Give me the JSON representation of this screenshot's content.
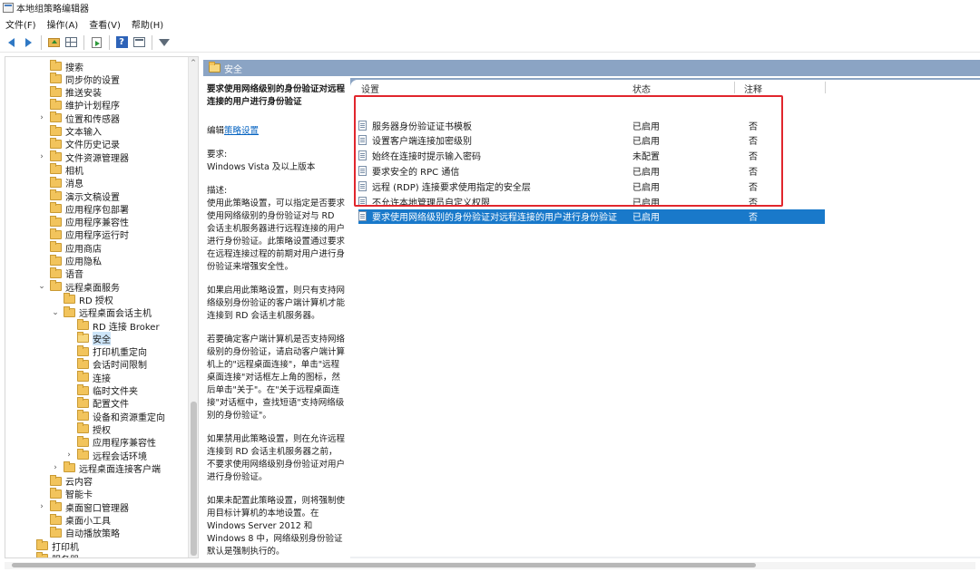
{
  "window": {
    "title": "本地组策略编辑器"
  },
  "menu": [
    "文件(F)",
    "操作(A)",
    "查看(V)",
    "帮助(H)"
  ],
  "toolbar": {
    "icons": [
      "back-arrow-icon",
      "forward-arrow-icon",
      "up-folder-icon",
      "show-hide-tree-icon",
      "export-list-icon",
      "help-icon",
      "properties-icon",
      "filter-icon"
    ],
    "help_glyph": "?"
  },
  "tree": {
    "items": [
      {
        "label": "搜索"
      },
      {
        "label": "同步你的设置"
      },
      {
        "label": "推送安装"
      },
      {
        "label": "维护计划程序"
      },
      {
        "label": "位置和传感器",
        "expander": "›"
      },
      {
        "label": "文本输入"
      },
      {
        "label": "文件历史记录"
      },
      {
        "label": "文件资源管理器",
        "expander": "›"
      },
      {
        "label": "相机"
      },
      {
        "label": "消息"
      },
      {
        "label": "演示文稿设置"
      },
      {
        "label": "应用程序包部署"
      },
      {
        "label": "应用程序兼容性"
      },
      {
        "label": "应用程序运行时"
      },
      {
        "label": "应用商店"
      },
      {
        "label": "应用隐私"
      },
      {
        "label": "语音"
      },
      {
        "label": "远程桌面服务",
        "expander": "⌄"
      },
      {
        "label": "RD 授权"
      },
      {
        "label": "远程桌面会话主机",
        "expander": "⌄"
      },
      {
        "label": "RD 连接 Broker"
      },
      {
        "label": "安全",
        "selected": true
      },
      {
        "label": "打印机重定向"
      },
      {
        "label": "会话时间限制"
      },
      {
        "label": "连接"
      },
      {
        "label": "临时文件夹"
      },
      {
        "label": "配置文件"
      },
      {
        "label": "设备和资源重定向"
      },
      {
        "label": "授权"
      },
      {
        "label": "应用程序兼容性"
      },
      {
        "label": "远程会话环境",
        "expander": "›"
      },
      {
        "label": "远程桌面连接客户端",
        "expander": "›"
      },
      {
        "label": "云内容"
      },
      {
        "label": "智能卡"
      },
      {
        "label": "桌面窗口管理器",
        "expander": "›"
      },
      {
        "label": "桌面小工具"
      },
      {
        "label": "自动播放策略"
      },
      {
        "label": "打印机"
      },
      {
        "label": "服务器"
      }
    ],
    "scroll_up_glyph": "^"
  },
  "header": {
    "title": "安全"
  },
  "description": {
    "title": "要求使用网络级别的身份验证对远程连接的用户进行身份验证",
    "edit_prefix": "编辑",
    "edit_link": "策略设置",
    "req_label": "要求:",
    "req_value": "Windows Vista 及以上版本",
    "desc_label": "描述:",
    "p1": "使用此策略设置，可以指定是否要求使用网络级别的身份验证对与 RD 会话主机服务器进行远程连接的用户进行身份验证。此策略设置通过要求在远程连接过程的前期对用户进行身份验证来增强安全性。",
    "p2": "如果启用此策略设置，则只有支持网络级别身份验证的客户端计算机才能连接到 RD 会话主机服务器。",
    "p3": "若要确定客户端计算机是否支持网络级别的身份验证，请启动客户端计算机上的\"远程桌面连接\"，单击\"远程桌面连接\"对话框左上角的图标，然后单击\"关于\"。在\"关于远程桌面连接\"对话框中，查找短语\"支持网络级别的身份验证\"。",
    "p4": "如果禁用此策略设置，则在允许远程连接到 RD 会话主机服务器之前，不要求使用网络级别身份验证对用户进行身份验证。",
    "p5": "如果未配置此策略设置，则将强制使用目标计算机的本地设置。在 Windows Server 2012 和 Windows 8 中，网络级别身份验证默认是强制执行的。"
  },
  "list": {
    "columns": {
      "setting": "设置",
      "state": "状态",
      "note": "注释"
    },
    "rows": [
      {
        "name": "服务器身份验证证书模板",
        "state": "已启用",
        "note": "否"
      },
      {
        "name": "设置客户端连接加密级别",
        "state": "已启用",
        "note": "否"
      },
      {
        "name": "始终在连接时提示输入密码",
        "state": "未配置",
        "note": "否"
      },
      {
        "name": "要求安全的 RPC 通信",
        "state": "已启用",
        "note": "否"
      },
      {
        "name": "远程 (RDP) 连接要求使用指定的安全层",
        "state": "已启用",
        "note": "否"
      },
      {
        "name": "不允许本地管理员自定义权限",
        "state": "已启用",
        "note": "否"
      },
      {
        "name": "要求使用网络级别的身份验证对远程连接的用户进行身份验证",
        "state": "已启用",
        "note": "否",
        "selected": true
      }
    ]
  },
  "colors": {
    "accent": "#1979ca",
    "band": "#8ba4c4",
    "highlight_box": "#e1262d"
  }
}
